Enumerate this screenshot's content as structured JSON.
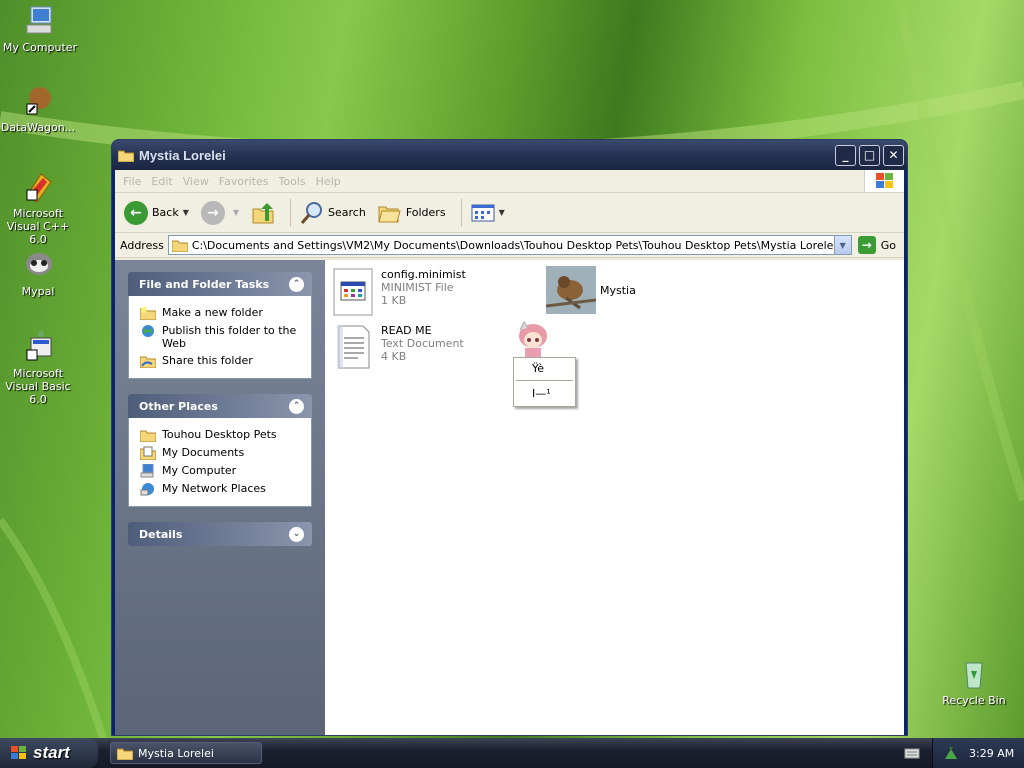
{
  "desktop": {
    "icons": [
      {
        "label": "My Computer"
      },
      {
        "label": "DataWagon..."
      },
      {
        "label": "Microsoft Visual C++ 6.0"
      },
      {
        "label": "Mypal"
      },
      {
        "label": "Microsoft Visual Basic 6.0"
      },
      {
        "label": "Recycle Bin"
      }
    ]
  },
  "window": {
    "title": "Mystia Lorelei",
    "menu": [
      "File",
      "Edit",
      "View",
      "Favorites",
      "Tools",
      "Help"
    ],
    "toolbar": {
      "back_label": "Back",
      "search_label": "Search",
      "folders_label": "Folders"
    },
    "address": {
      "label": "Address",
      "value": "C:\\Documents and Settings\\VM2\\My Documents\\Downloads\\Touhou Desktop Pets\\Touhou Desktop Pets\\Mystia Lorelei",
      "go_label": "Go"
    },
    "tasks": {
      "file_folder_title": "File and Folder Tasks",
      "file_folder_items": [
        "Make a new folder",
        "Publish this folder to the Web",
        "Share this folder"
      ],
      "other_places_title": "Other Places",
      "other_places_items": [
        "Touhou Desktop Pets",
        "My Documents",
        "My Computer",
        "My Network Places"
      ],
      "details_title": "Details"
    },
    "files": [
      {
        "name": "config.minimist",
        "type": "MINIMIST File",
        "size": "1 KB"
      },
      {
        "name": "Mystia",
        "type": "",
        "size": ""
      },
      {
        "name": "READ ME",
        "type": "Text Document",
        "size": "4 KB"
      }
    ]
  },
  "context_menu": {
    "items": [
      "Ÿè",
      "I—¹"
    ]
  },
  "taskbar": {
    "start_label": "start",
    "task_label": "Mystia Lorelei",
    "clock": "3:29 AM"
  },
  "colors": {
    "titlebar": "#222f4f",
    "taskpane": "#6b7588",
    "link_blue": "#215dc6"
  }
}
